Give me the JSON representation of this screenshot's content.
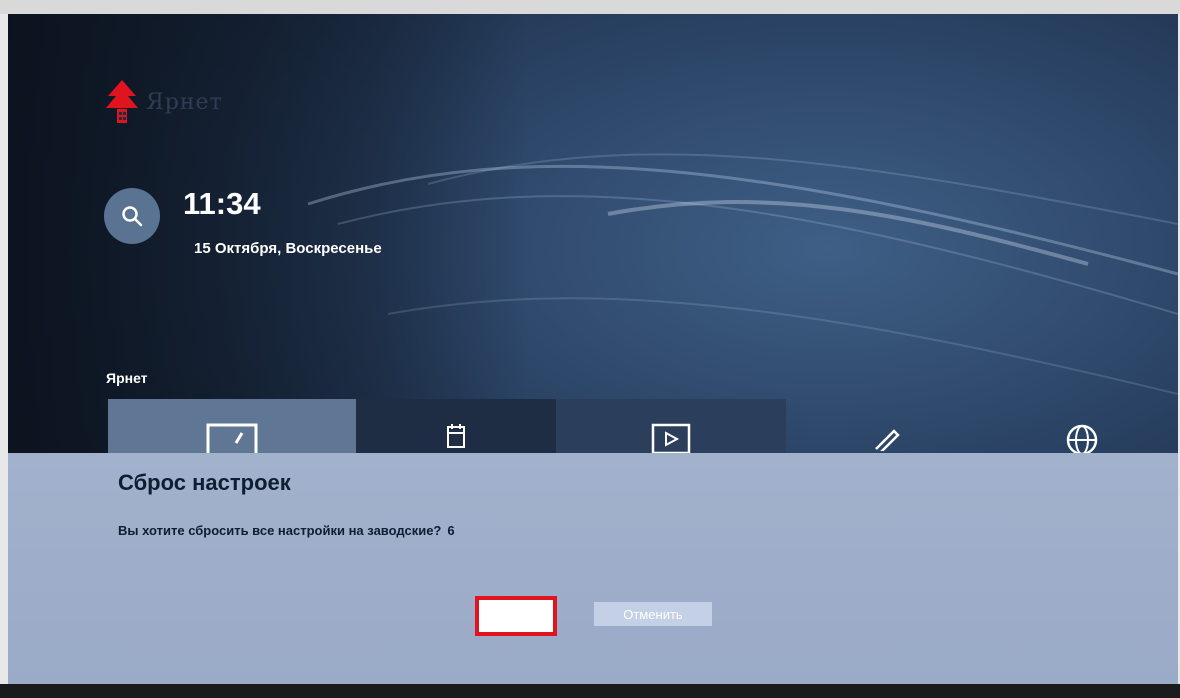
{
  "brand": {
    "name": "Ярнет",
    "logo_icon": "house-logo-icon",
    "accent_color": "#e0141e"
  },
  "header": {
    "search_icon": "search-icon",
    "time": "11:34",
    "date": "15 Октября, Воскресенье"
  },
  "row": {
    "title": "Ярнет",
    "tiles": [
      {
        "icon": "tv-icon"
      },
      {
        "icon": "calendar-icon"
      },
      {
        "icon": "play-icon"
      },
      {
        "icon": "pencil-icon"
      },
      {
        "icon": "globe-icon"
      }
    ]
  },
  "dialog": {
    "title": "Сброс настроек",
    "message": "Вы хотите сбросить все настройки на заводские?",
    "countdown": "6",
    "confirm_label": "",
    "cancel_label": "Отменить"
  }
}
